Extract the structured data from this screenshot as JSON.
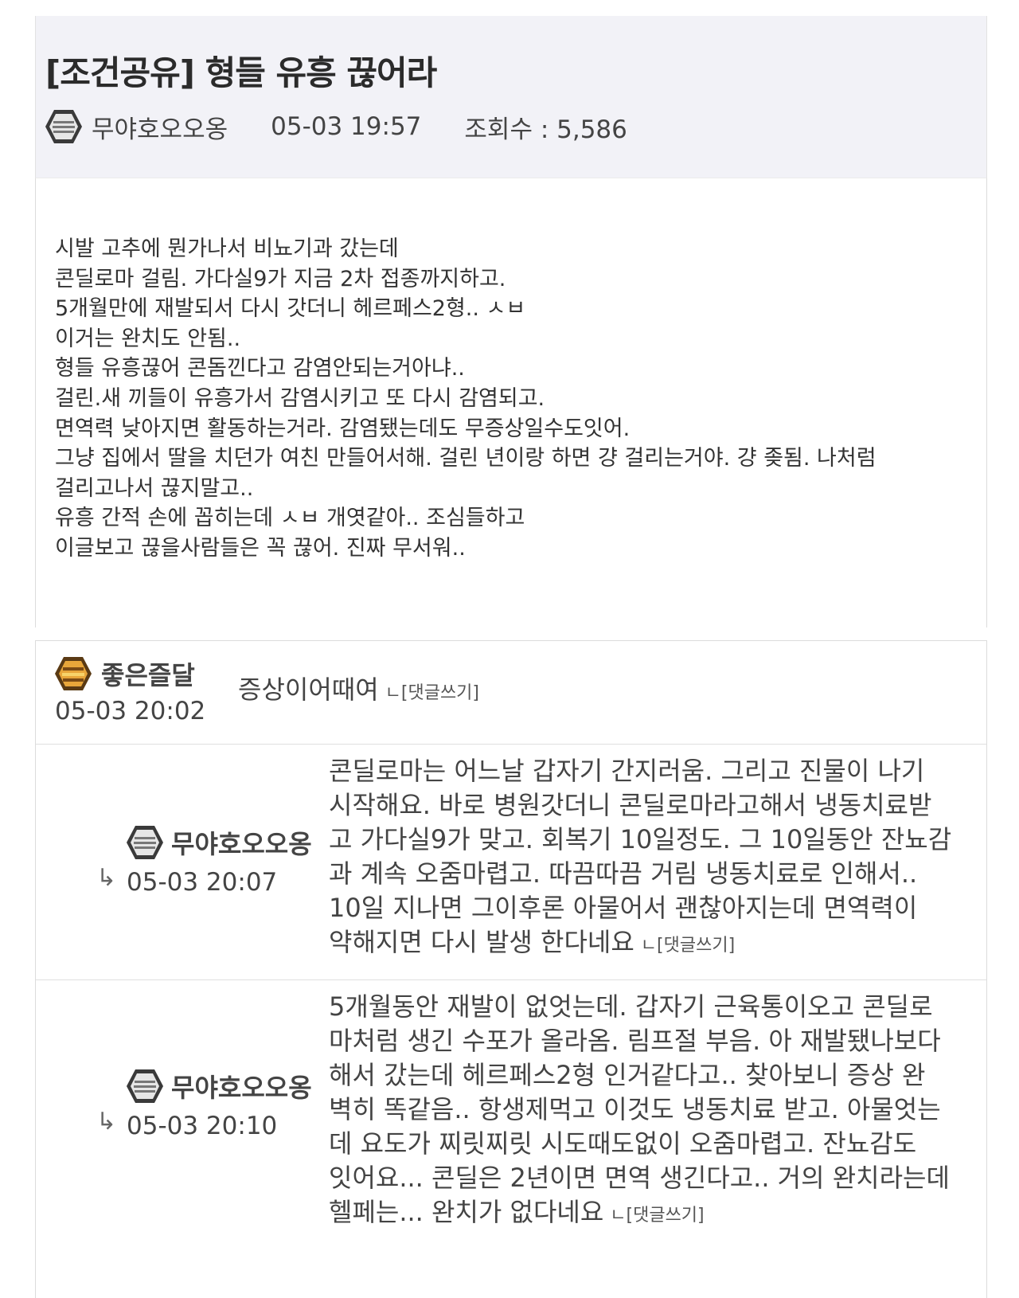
{
  "post": {
    "title": "[조건공유] 형들 유흥 끊어라",
    "author": "무야호오오옹",
    "date": "05-03 19:57",
    "views": "조회수 : 5,586",
    "body_lines": [
      "시발 고추에 뭔가나서 비뇨기과 갔는데",
      "콘딜로마 걸림. 가다실9가 지금 2차 접종까지하고.",
      "5개월만에 재발되서 다시 갓더니 헤르페스2형.. ㅅㅂ",
      "이거는 완치도 안됨..",
      "형들 유흥끊어 콘돔낀다고 감염안되는거아냐..",
      "걸린.새 끼들이 유흥가서 감염시키고 또 다시 감염되고.",
      "면역력 낮아지면 활동하는거라. 감염됐는데도 무증상일수도잇어.",
      "그냥 집에서 딸을 치던가 여친 만들어서해. 걸린 년이랑 하면 걍 걸리는거야. 걍 좆됨. 나처럼",
      "걸리고나서 끊지말고..",
      "유흥 간적 손에 꼽히는데 ㅅㅂ 개엿같아.. 조심들하고",
      "이글보고 끊을사람들은 꼭 끊어. 진짜 무서워.."
    ]
  },
  "reply_label": "ㄴ[댓글쓰기]",
  "reply_arrow": "↳",
  "comments": [
    {
      "author": "좋은즐달",
      "date": "05-03 20:02",
      "lines": [
        "증상이어때여"
      ]
    },
    {
      "author": "무야호오오옹",
      "date": "05-03 20:07",
      "lines": [
        "콘딜로마는 어느날 갑자기 간지러움. 그리고 진물이 나기",
        "시작해요. 바로 병원갓더니 콘딜로마라고해서 냉동치료받",
        "고 가다실9가 맞고. 회복기 10일정도. 그 10일동안 잔뇨감",
        "과 계속 오줌마렵고. 따끔따끔 거림 냉동치료로 인해서..",
        "10일 지나면 그이후론 아물어서 괜찮아지는데 면역력이",
        "약해지면 다시 발생 한다네요"
      ]
    },
    {
      "author": "무야호오오옹",
      "date": "05-03 20:10",
      "lines": [
        "5개월동안 재발이 없엇는데. 갑자기 근육통이오고 콘딜로",
        "마처럼 생긴 수포가 올라옴. 림프절 부음. 아 재발됐나보다",
        "해서 갔는데 헤르페스2형 인거같다고.. 찾아보니 증상 완",
        "벽히 똑같음.. 항생제먹고 이것도 냉동치료 받고. 아물엇는",
        "데 요도가 찌릿찌릿 시도때도없이 오줌마렵고. 잔뇨감도",
        "잇어요... 콘딜은 2년이면 면역 생긴다고.. 거의 완치라는데",
        "헬페는... 완치가 없다네요"
      ]
    }
  ]
}
